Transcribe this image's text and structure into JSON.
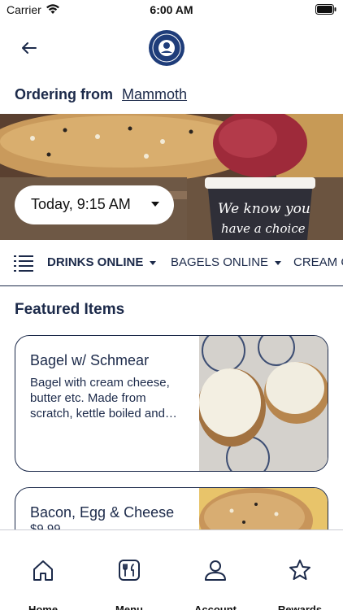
{
  "status_bar": {
    "carrier": "Carrier",
    "time": "6:00 AM"
  },
  "header": {
    "back_icon": "arrow-left-icon",
    "logo_alt": "OLD NEW YORK DELI & BAKERY CO."
  },
  "ordering": {
    "label": "Ordering from",
    "location": "Mammoth"
  },
  "time_picker": {
    "value": "Today, 9:15 AM"
  },
  "categories": [
    {
      "label": "DRINKS ONLINE",
      "selected": true
    },
    {
      "label": "BAGELS ONLINE",
      "selected": false
    },
    {
      "label": "CREAM C",
      "selected": false
    }
  ],
  "featured": {
    "title": "Featured Items",
    "items": [
      {
        "name": "Bagel w/ Schmear",
        "description": "Bagel with cream cheese, butter etc. Made from scratch, kettle boiled and…"
      },
      {
        "name": "Bacon, Egg & Cheese",
        "price": "$9.99"
      }
    ]
  },
  "tab_bar": [
    {
      "label": "Home",
      "icon": "home-icon"
    },
    {
      "label": "Menu",
      "icon": "menu-icon"
    },
    {
      "label": "Account",
      "icon": "account-icon"
    },
    {
      "label": "Rewards",
      "icon": "star-icon"
    }
  ],
  "colors": {
    "navy": "#1c2a4a",
    "background": "#ffffff"
  }
}
